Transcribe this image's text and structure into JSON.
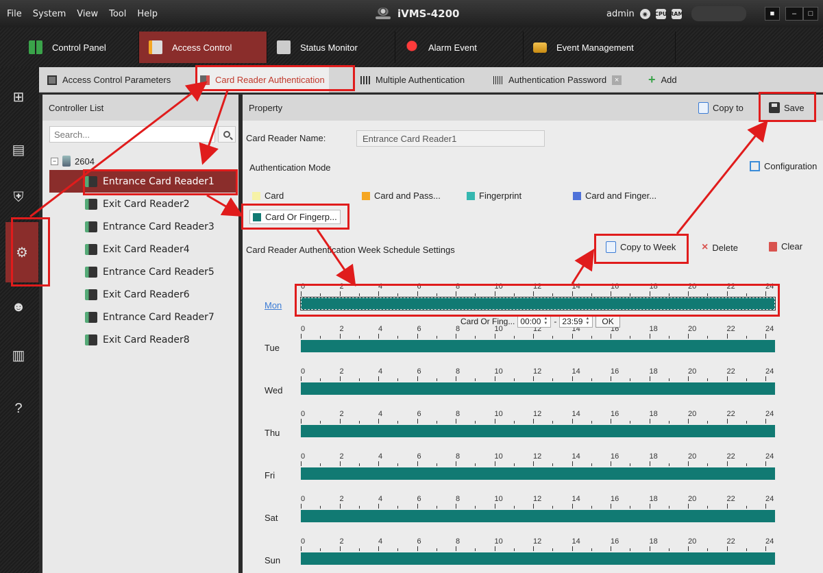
{
  "menu": {
    "items": [
      "File",
      "System",
      "View",
      "Tool",
      "Help"
    ]
  },
  "app": {
    "title": "iVMS-4200",
    "user": "admin",
    "status_icons": [
      "globe-icon",
      "cpu-icon",
      "ram-icon"
    ],
    "lock_label": "🔒",
    "minimize_label": "–",
    "maximize_label": "□"
  },
  "modules": [
    {
      "label": "Control Panel",
      "icon": "control-panel-icon"
    },
    {
      "label": "Access Control",
      "icon": "access-control-icon"
    },
    {
      "label": "Status Monitor",
      "icon": "status-monitor-icon"
    },
    {
      "label": "Alarm Event",
      "icon": "alarm-event-icon"
    },
    {
      "label": "Event Management",
      "icon": "event-management-icon"
    }
  ],
  "subtabs": [
    {
      "label": "Access Control Parameters"
    },
    {
      "label": "Card Reader Authentication"
    },
    {
      "label": "Multiple Authentication"
    },
    {
      "label": "Authentication Password"
    },
    {
      "label": "Add"
    }
  ],
  "controller": {
    "header": "Controller List",
    "search_placeholder": "Search...",
    "root": "2604",
    "readers": [
      "Entrance Card Reader1",
      "Exit Card Reader2",
      "Entrance Card Reader3",
      "Exit Card Reader4",
      "Entrance Card Reader5",
      "Exit Card Reader6",
      "Entrance Card Reader7",
      "Exit Card Reader8"
    ]
  },
  "property": {
    "header": "Property",
    "copy_to": "Copy to",
    "save": "Save",
    "card_reader_name_label": "Card Reader Name:",
    "card_reader_name_value": "Entrance Card Reader1",
    "auth_mode_label": "Authentication Mode",
    "configuration": "Configuration",
    "legend": [
      {
        "label": "Card",
        "color": "#f6f2a7"
      },
      {
        "label": "Card and Pass...",
        "color": "#f5a623"
      },
      {
        "label": "Fingerprint",
        "color": "#35b7b0"
      },
      {
        "label": "Card and Finger...",
        "color": "#4f72d9"
      },
      {
        "label": "Card Or Fingerp...",
        "color": "#117a73"
      }
    ],
    "week_title": "Card Reader Authentication Week Schedule Settings",
    "copy_to_week": "Copy to Week",
    "delete": "Delete",
    "clear": "Clear",
    "days": [
      "Mon",
      "Tue",
      "Wed",
      "Thu",
      "Fri",
      "Sat",
      "Sun"
    ],
    "ticks": [
      "0",
      "2",
      "4",
      "6",
      "8",
      "10",
      "12",
      "14",
      "16",
      "18",
      "20",
      "22",
      "24"
    ],
    "editor": {
      "mode": "Card Or Fing...",
      "start": "00:00",
      "separator": "-",
      "end": "23:59",
      "ok": "OK"
    }
  }
}
